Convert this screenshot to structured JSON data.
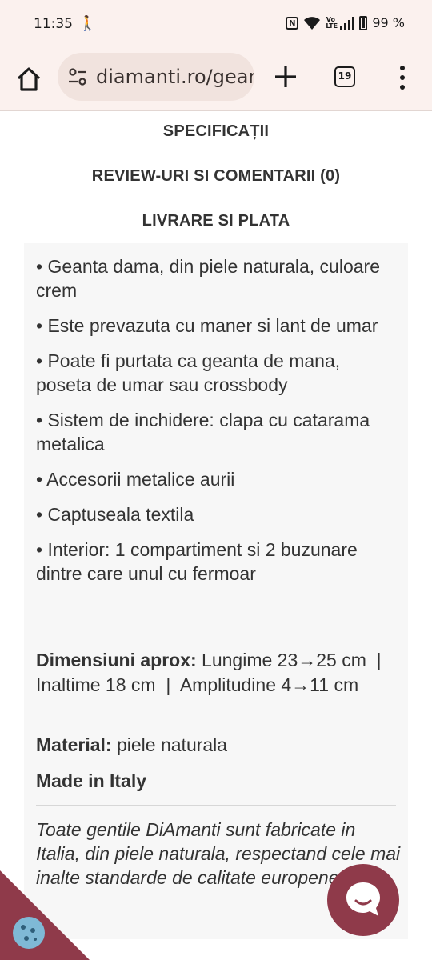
{
  "status_bar": {
    "time": "11:35",
    "battery": "99 %"
  },
  "browser": {
    "url": "diamanti.ro/gear",
    "tab_count": "19"
  },
  "tabs": {
    "specs": "SPECIFICAȚII",
    "reviews": "REVIEW-URI SI COMENTARII (0)",
    "delivery": "LIVRARE SI PLATA"
  },
  "specs": {
    "items": [
      "• Geanta dama, din piele naturala, culoare crem",
      "• Este prevazuta cu maner si lant de umar",
      "• Poate fi purtata ca geanta de mana, poseta de umar sau crossbody",
      "• Sistem de inchidere: clapa cu catarama metalica",
      "• Accesorii metalice aurii",
      "• Captuseala textila",
      "• Interior: 1 compartiment si 2 buzunare dintre care unul cu fermoar"
    ],
    "dimensions_label": "Dimensiuni aprox:",
    "dimensions_value": " Lungime 23→25 cm  |  Inaltime 18 cm  |  Amplitudine 4→11 cm",
    "material_label": "Material:",
    "material_value": " piele naturala",
    "made_in": "Made in Italy",
    "note": "Toate gentile DiAmanti sunt fabricate in Italia, din piele naturala, respectand cele mai inalte standarde de calitate europene."
  },
  "icons": {
    "accent": "#8f3a4a",
    "cookie": "cookie-icon",
    "chat": "chat-icon"
  }
}
